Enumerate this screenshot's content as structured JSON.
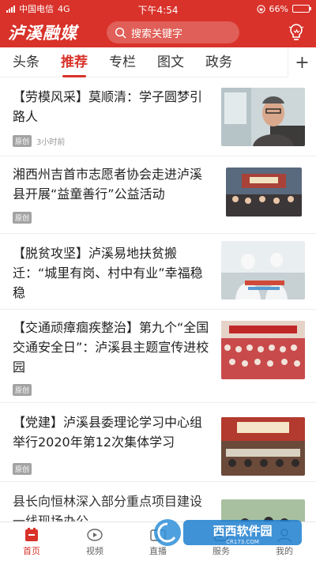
{
  "status": {
    "carrier": "中国电信",
    "network": "4G",
    "time": "下午4:54",
    "battery": "66%",
    "battery_level": 0.66
  },
  "header": {
    "logo": "泸溪融媒",
    "search_placeholder": "搜索关键字"
  },
  "tabs": [
    "头条",
    "推荐",
    "专栏",
    "图文",
    "政务"
  ],
  "active_tab": "推荐",
  "articles": [
    {
      "title": "【劳模风采】莫顺清：学子圆梦引路人",
      "badge": "原创",
      "time": "3小时前"
    },
    {
      "title": "湘西州吉首市志愿者协会走进泸溪县开展“益童善行”公益活动",
      "badge": "原创",
      "time": ""
    },
    {
      "title": "【脱贫攻坚】泸溪易地扶贫搬迁：“城里有岗、村中有业”幸福稳稳",
      "badge": "",
      "time": ""
    },
    {
      "title": "【交通顽瘴痼疾整治】第九个“全国交通安全日”：泸溪县主题宣传进校园",
      "badge": "原创",
      "time": ""
    },
    {
      "title": "【党建】泸溪县委理论学习中心组举行2020年第12次集体学习",
      "badge": "原创",
      "time": ""
    },
    {
      "title": "县长向恒林深入部分重点项目建设一线现场办公",
      "badge": "",
      "time": ""
    }
  ],
  "bottom_nav": [
    {
      "label": "首页",
      "icon": "home-icon"
    },
    {
      "label": "视频",
      "icon": "video-icon"
    },
    {
      "label": "直播",
      "icon": "live-icon"
    },
    {
      "label": "服务",
      "icon": "service-icon"
    },
    {
      "label": "我的",
      "icon": "user-icon"
    }
  ],
  "watermark": {
    "text": "西西软件园",
    "url": "CR173.COM"
  },
  "colors": {
    "brand": "#d8322a"
  }
}
